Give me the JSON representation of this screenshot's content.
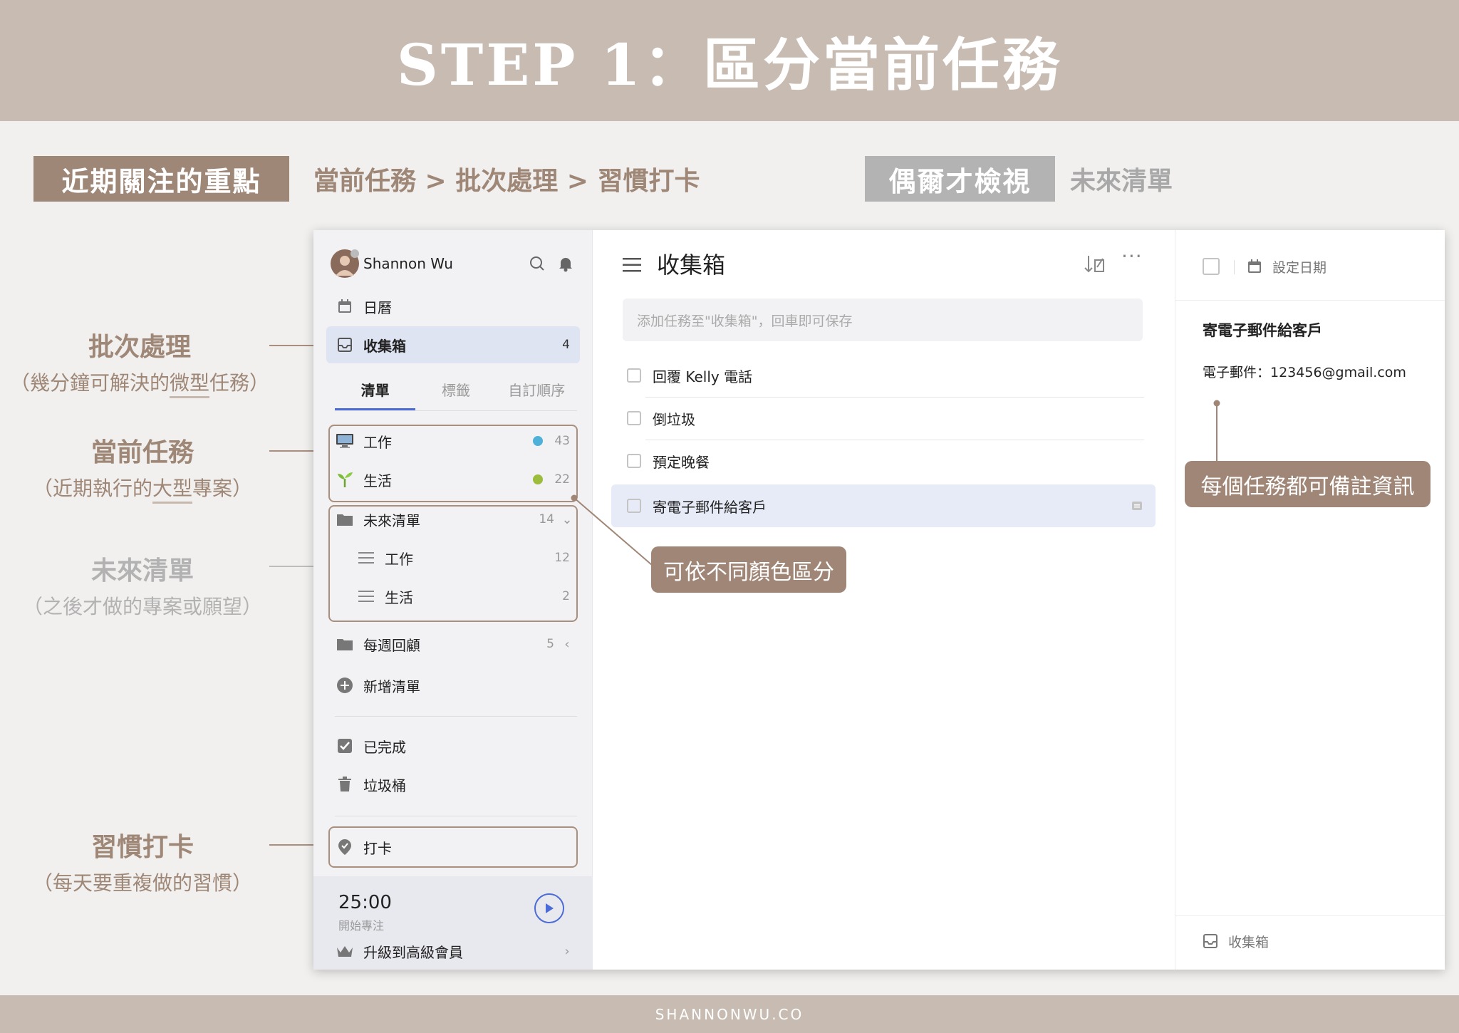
{
  "banner": {
    "title": "STEP 1：區分當前任務"
  },
  "footer": {
    "site": "SHANNONWU.CO"
  },
  "legend": {
    "focus_label": "近期關注的重點",
    "focus_order": "當前任務 > 批次處理 > 習慣打卡",
    "occasional_label": "偶爾才檢視",
    "occasional_value": "未來清單"
  },
  "side_labels": {
    "batch": {
      "title": "批次處理",
      "sub_before": "（幾分鐘可解決的",
      "sub_under": "微型",
      "sub_after": "任務）"
    },
    "current": {
      "title": "當前任務",
      "sub_before": "（近期執行的",
      "sub_under": "大型",
      "sub_after": "專案）"
    },
    "future": {
      "title": "未來清單",
      "sub": "（之後才做的專案或願望）"
    },
    "habit": {
      "title": "習慣打卡",
      "sub": "（每天要重複做的習慣）"
    }
  },
  "sidebar": {
    "user_name": "Shannon Wu",
    "calendar": "日曆",
    "inbox": {
      "label": "收集箱",
      "count": "4"
    },
    "tabs": [
      "清單",
      "標籤",
      "自訂順序"
    ],
    "lists": [
      {
        "label": "工作",
        "count": "43",
        "color": "#4fb0d8"
      },
      {
        "label": "生活",
        "count": "22",
        "color": "#9cbc3d"
      }
    ],
    "future_folder": {
      "label": "未來清單",
      "count": "14",
      "children": [
        {
          "label": "工作",
          "count": "12"
        },
        {
          "label": "生活",
          "count": "2"
        }
      ]
    },
    "weekly": {
      "label": "每週回顧",
      "count": "5"
    },
    "add_list": "新增清單",
    "completed": "已完成",
    "trash": "垃圾桶",
    "habit": "打卡",
    "pomo": {
      "time": "25:00",
      "label": "開始專注"
    },
    "upgrade": "升級到高級會員"
  },
  "main": {
    "title": "收集箱",
    "input_placeholder": "添加任務至\"收集箱\"，回車即可保存",
    "tasks": [
      "回覆 Kelly 電話",
      "倒垃圾",
      "預定晚餐",
      "寄電子郵件給客戶"
    ]
  },
  "detail": {
    "set_date": "設定日期",
    "task_title": "寄電子郵件給客戶",
    "note": "電子郵件：123456@gmail.com",
    "footer_list": "收集箱"
  },
  "callouts": {
    "color": "可依不同顏色區分",
    "note": "每個任務都可備註資訊"
  },
  "colors": {
    "accent_brown": "#a08676",
    "banner": "#c8bcb2",
    "selected": "#e7ebf8"
  }
}
